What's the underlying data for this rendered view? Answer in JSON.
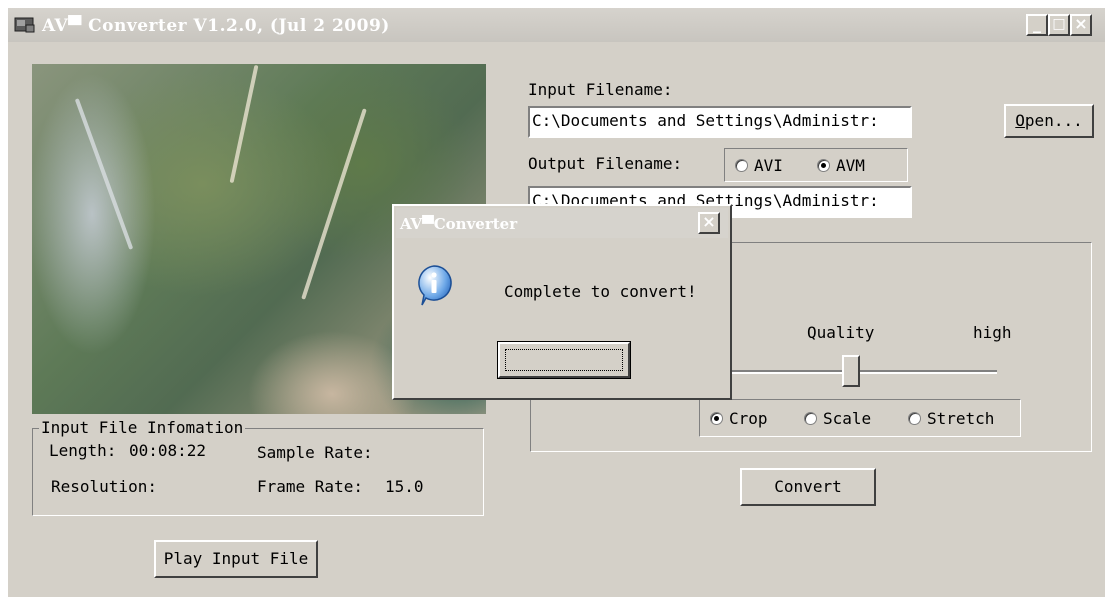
{
  "window": {
    "title": "AV▀ Converter V1.2.0, (Jul  2 2009)",
    "icon": "app-icon",
    "controls": {
      "minimize": "_",
      "maximize": "□",
      "close": "×"
    }
  },
  "input": {
    "label": "Input Filename:",
    "value": "C:\\Documents and Settings\\Administr:",
    "open_button": "Open..."
  },
  "output": {
    "label": "Output Filename:",
    "format_options": [
      {
        "label": "AVI",
        "selected": false
      },
      {
        "label": "AVM",
        "selected": true
      }
    ],
    "value": "C:\\Documents and Settings\\Administr:"
  },
  "quality": {
    "label": "Quality",
    "high_label": "high",
    "level": 0.45
  },
  "resize_mode": {
    "options": [
      {
        "label": "Crop",
        "selected": true
      },
      {
        "label": "Scale",
        "selected": false
      },
      {
        "label": "Stretch",
        "selected": false
      }
    ]
  },
  "convert_button": "Convert",
  "file_info": {
    "title": "Input File Infomation",
    "length_label": "Length:",
    "length_value": "00:08:22",
    "sample_rate_label": "Sample Rate:",
    "resolution_label": "Resolution:",
    "frame_rate_label": "Frame Rate:",
    "frame_rate_value": "15.0"
  },
  "play_button": "Play Input File",
  "dialog": {
    "title": "AV▀Converter",
    "close": "×",
    "icon": "info-icon",
    "message": "Complete to convert!",
    "ok_label": ""
  }
}
